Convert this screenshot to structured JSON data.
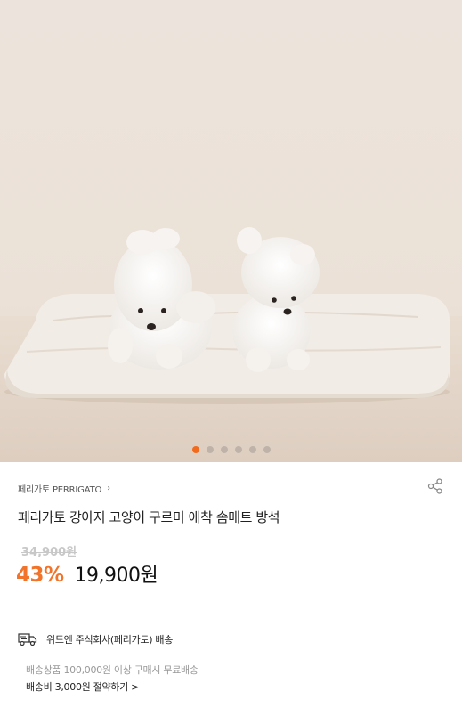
{
  "gallery": {
    "image_alt": "product-photo-two-white-pomeranians-on-mat",
    "slide_count": 6,
    "active_index": 0,
    "active_dot_color": "#f26b1d"
  },
  "product": {
    "brand": "페리가토 PERRIGATO",
    "brand_chevron": "›",
    "title": "페리가토 강아지 고양이 구르미 애착 솜매트 방석",
    "original_price": "34,900원",
    "discount": "43%",
    "price": "19,900원",
    "discount_color": "#f2742a"
  },
  "shipping": {
    "seller_line": "위드앤 주식회사(페리가토) 배송",
    "condition": "배송상품 100,000원 이상 구매시 무료배송",
    "fee_line": "배송비 3,000원 절약하기 >"
  },
  "icons": {
    "share": "share-icon",
    "truck": "delivery-truck-icon"
  }
}
